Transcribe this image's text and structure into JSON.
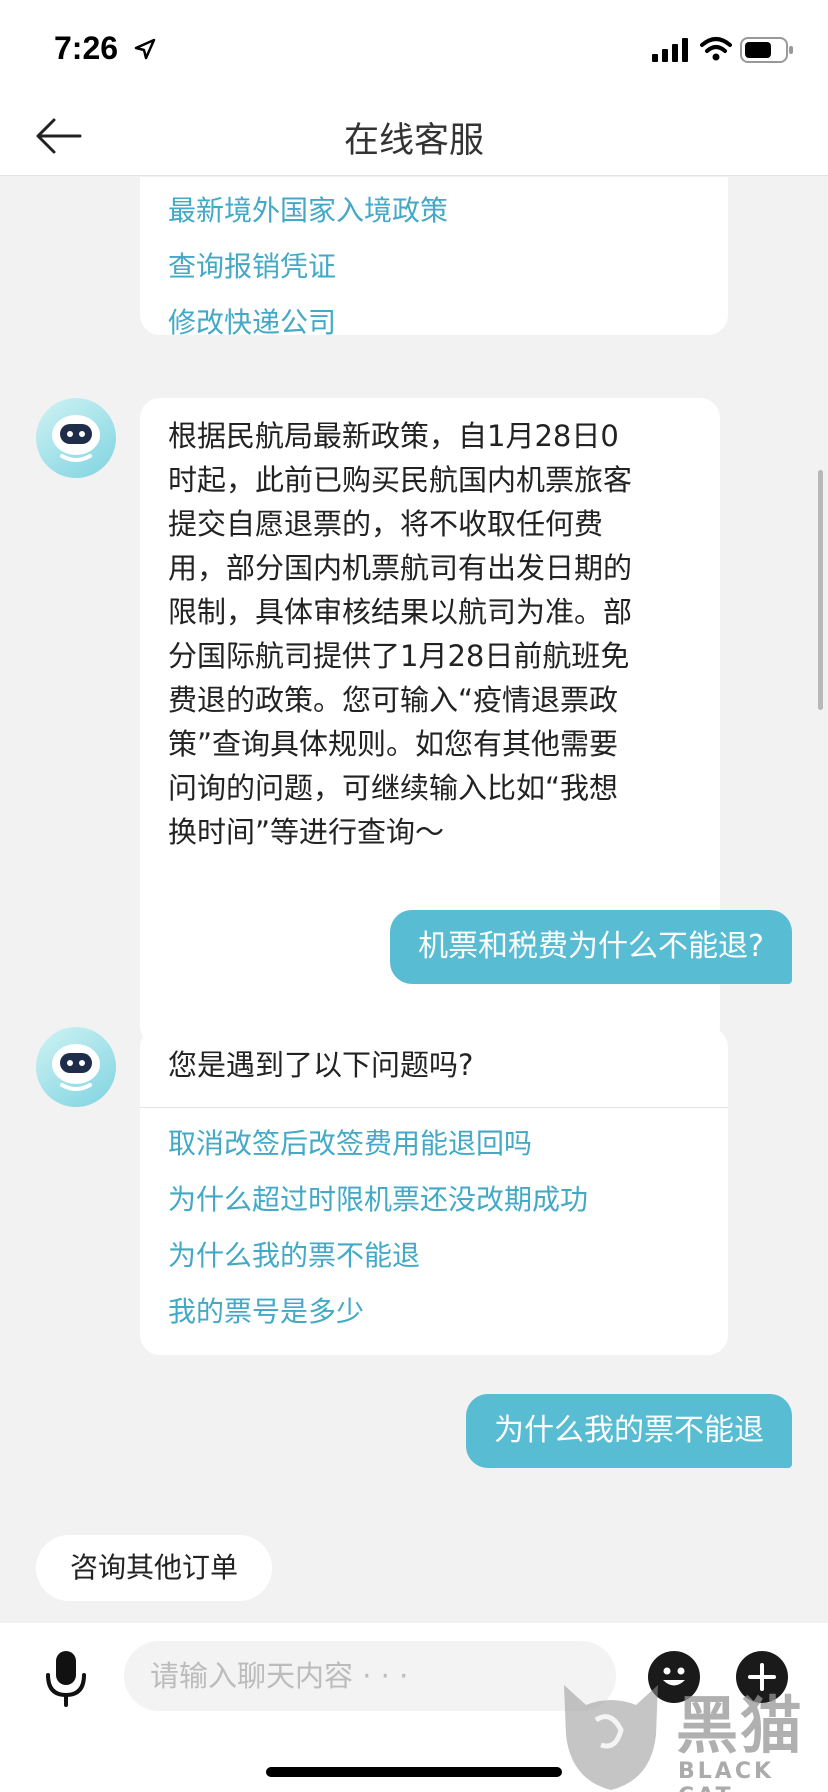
{
  "status_bar": {
    "time": "7:26"
  },
  "nav": {
    "title": "在线客服"
  },
  "messages": {
    "top_card": {
      "links": [
        "最新境外国家入境政策",
        "查询报销凭证",
        "修改快递公司"
      ]
    },
    "bot_reply_1": {
      "lines": [
        "根据民航局最新政策，自1月28日0",
        "时起，此前已购买民航国内机票旅客",
        "提交自愿退票的，将不收取任何费",
        "用，部分国内机票航司有出发日期的",
        "限制，具体审核结果以航司为准。部",
        "分国际航司提供了1月28日前航班免",
        "费退的政策。您可输入“疫情退票政",
        "策”查询具体规则。如您有其他需要",
        "问询的问题，可继续输入比如“我想",
        "换时间”等进行查询～"
      ]
    },
    "user_1": "机票和税费为什么不能退?",
    "bot_reply_2": {
      "heading": "您是遇到了以下问题吗?",
      "links": [
        "取消改签后改签费用能退回吗",
        "为什么超过时限机票还没改期成功",
        "为什么我的票不能退",
        "我的票号是多少"
      ]
    },
    "user_2": "为什么我的票不能退"
  },
  "quick_reply": {
    "label": "咨询其他订单"
  },
  "input": {
    "placeholder": "请输入聊天内容 · · ·"
  },
  "watermark": {
    "cn": "黑猫",
    "en": "BLACK CAT"
  },
  "colors": {
    "accent": "#58bcd3",
    "link": "#43a9c6",
    "background": "#f2f2f2"
  },
  "icons": [
    "location-arrow-icon",
    "signal-icon",
    "wifi-icon",
    "battery-icon",
    "back-arrow-icon",
    "robot-avatar-icon",
    "microphone-icon",
    "emoji-icon",
    "plus-icon"
  ]
}
